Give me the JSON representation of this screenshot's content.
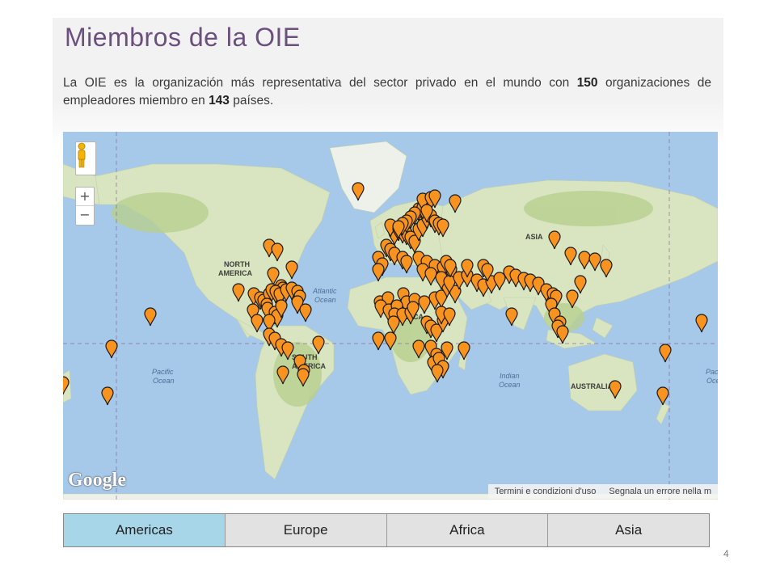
{
  "header": {
    "title": "Miembros de la OIE"
  },
  "intro": {
    "text_before": "La OIE es la organización más representativa del sector privado en el mundo con ",
    "org_count": "150",
    "text_middle": " organizaciones de empleadores miembro en ",
    "country_count": "143",
    "text_after": " países."
  },
  "map": {
    "land_labels": {
      "north_america": [
        "NORTH",
        "AMERICA"
      ],
      "south_america": [
        "SOUTH",
        "AMERICA"
      ],
      "africa": "AFRICA",
      "asia": "ASIA",
      "australia": "AUSTRALIA"
    },
    "ocean_labels": {
      "atlantic": [
        "Atlantic",
        "Ocean"
      ],
      "pacific_west": [
        "Pacific",
        "Ocean"
      ],
      "indian": [
        "Indian",
        "Ocean"
      ],
      "pacific_east": [
        "Pacific",
        "Oce"
      ]
    },
    "logo": "Google",
    "footer": {
      "terms": "Termini e condizioni d'uso",
      "report": "Segnala un errore nella m"
    },
    "colors": {
      "water": "#a6c8e9",
      "land": "#d9e4c0",
      "land_green": "#b8d08f",
      "pin": "#f7931e",
      "pin_outline": "#1a1a1a"
    }
  },
  "tabs": [
    {
      "label": "Americas",
      "active": true
    },
    {
      "label": "Europe",
      "active": false
    },
    {
      "label": "Africa",
      "active": false
    },
    {
      "label": "Asia",
      "active": false
    }
  ],
  "page_number": "4"
}
